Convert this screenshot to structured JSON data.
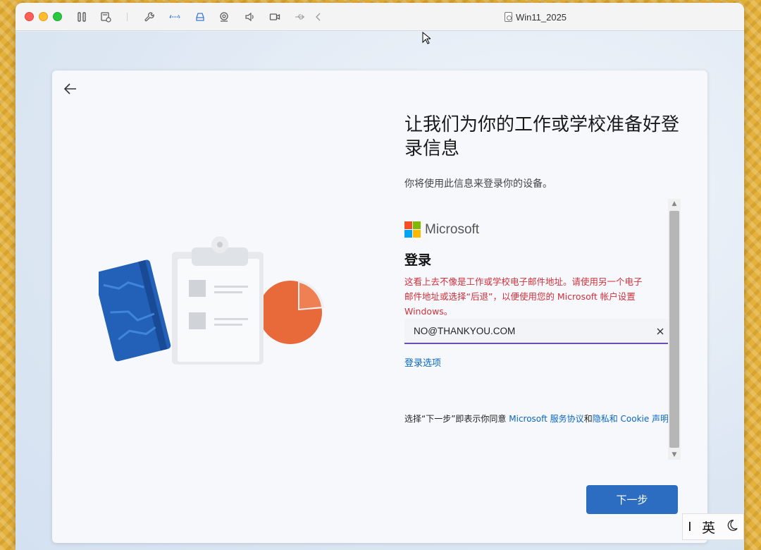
{
  "window": {
    "title": "Win11_2025"
  },
  "toolbar": {
    "icons": [
      "pause-icon",
      "snapshot-icon",
      "wrench-icon",
      "network-icon",
      "drive-icon",
      "camera-icon",
      "sound-icon",
      "video-icon",
      "usb-icon",
      "chevron-left-icon"
    ]
  },
  "oobe": {
    "heading": "让我们为你的工作或学校准备好登录信息",
    "subheading": "你将使用此信息来登录你的设备。",
    "brand": "Microsoft",
    "signin_title": "登录",
    "error_lines": [
      "这看上去不像是工作或学校电子邮件地址。请使用另一个电子",
      "邮件地址或选择“后退”，以便使用您的 Microsoft 帐户设置",
      "Windows。"
    ],
    "email_value": "NO@THANKYOU.COM",
    "signin_options": "登录选项",
    "terms_prefix": "选择“下一步”即表示你同意 ",
    "terms_link1": "Microsoft 服务协议",
    "terms_and": "和",
    "terms_link2": "隐私和 Cookie 声明",
    "terms_suffix": "。",
    "next_button": "下一步"
  },
  "ime": {
    "mode": "英"
  },
  "colors": {
    "accent": "#2c6dc2",
    "error": "#d1303b",
    "link": "#0a66c2",
    "ms_red": "#f25022",
    "ms_green": "#7fba00",
    "ms_blue": "#00a4ef",
    "ms_yellow": "#ffb900"
  }
}
